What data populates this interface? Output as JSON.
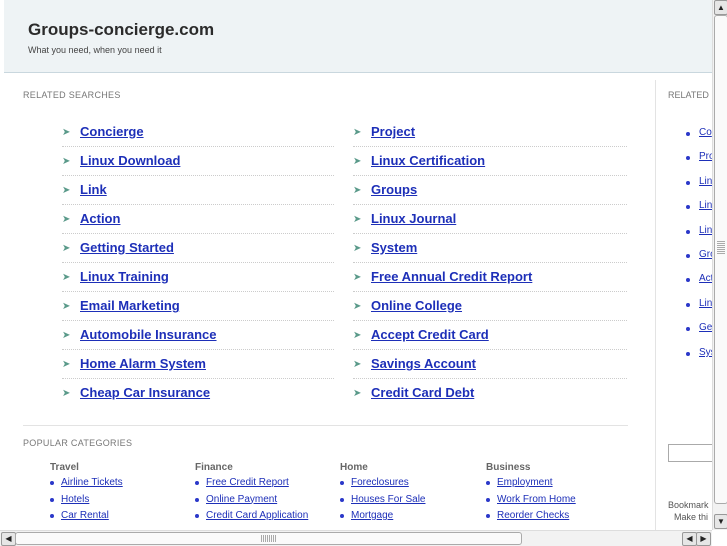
{
  "header": {
    "site_title": "Groups-concierge.com",
    "tagline": "What you need, when you need it"
  },
  "related": {
    "heading": "RELATED SEARCHES",
    "left": [
      "Concierge",
      "Linux Download",
      "Link",
      "Action",
      "Getting Started",
      "Linux Training",
      "Email Marketing",
      "Automobile Insurance",
      "Home Alarm System",
      "Cheap Car Insurance"
    ],
    "right": [
      "Project",
      "Linux Certification",
      "Groups",
      "Linux Journal",
      "System",
      "Free Annual Credit Report",
      "Online College",
      "Accept Credit Card",
      "Savings Account",
      "Credit Card Debt"
    ]
  },
  "popular": {
    "heading": "POPULAR CATEGORIES",
    "columns": [
      {
        "title": "Travel",
        "items": [
          "Airline Tickets",
          "Hotels",
          "Car Rental"
        ]
      },
      {
        "title": "Finance",
        "items": [
          "Free Credit Report",
          "Online Payment",
          "Credit Card Application"
        ]
      },
      {
        "title": "Home",
        "items": [
          "Foreclosures",
          "Houses For Sale",
          "Mortgage"
        ]
      },
      {
        "title": "Business",
        "items": [
          "Employment",
          "Work From Home",
          "Reorder Checks"
        ]
      }
    ]
  },
  "sidebar": {
    "heading": "RELATED",
    "items": [
      "Co",
      "Pro",
      "Lin",
      "Lin",
      "Lin",
      "Gro",
      "Act",
      "Lin",
      "Ge",
      "Sys"
    ],
    "bookmark_line1": "Bookmark",
    "bookmark_line2": "Make thi"
  },
  "icons": {
    "row_arrow": "arrow-right-icon",
    "bullet": "bullet-icon"
  }
}
